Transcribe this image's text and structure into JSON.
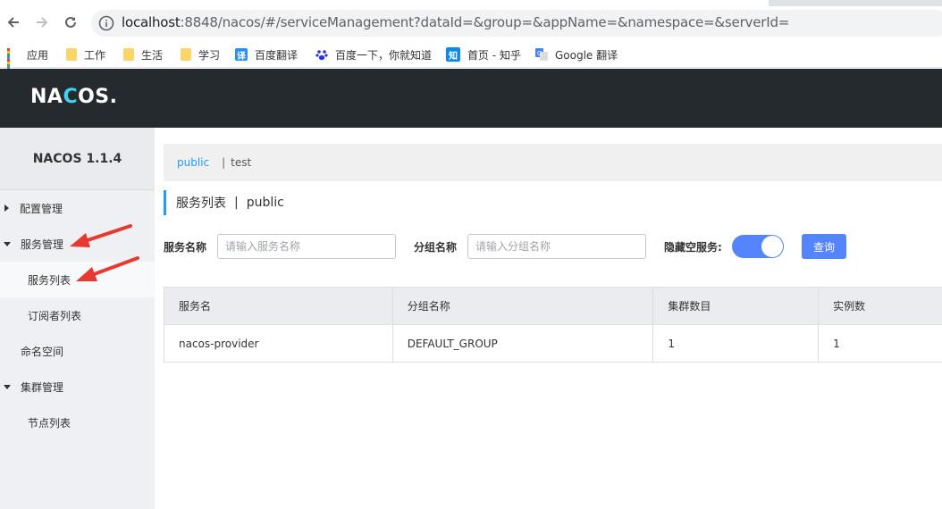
{
  "browser": {
    "url_host": "localhost",
    "url_rest": ":8848/nacos/#/serviceManagement?dataId=&group=&appName=&namespace=&serverId=",
    "bookmarks": [
      {
        "label": "应用",
        "icon": "apps-grid-icon"
      },
      {
        "label": "工作",
        "icon": "folder-icon"
      },
      {
        "label": "生活",
        "icon": "folder-icon"
      },
      {
        "label": "学习",
        "icon": "folder-icon"
      },
      {
        "label": "百度翻译",
        "icon": "baidu-translate-icon"
      },
      {
        "label": "百度一下，你就知道",
        "icon": "baidu-paw-icon"
      },
      {
        "label": "首页 - 知乎",
        "icon": "zhihu-icon"
      },
      {
        "label": "Google 翻译",
        "icon": "google-translate-icon"
      }
    ],
    "icons": {
      "baidu_translate": "译",
      "zhihu": "知"
    }
  },
  "header": {
    "logo_pre": "NA",
    "logo_o": "C",
    "logo_post": "OS."
  },
  "sidebar": {
    "version": "NACOS 1.1.4",
    "items": [
      {
        "label": "配置管理",
        "caret": "right"
      },
      {
        "label": "服务管理",
        "caret": "down"
      },
      {
        "label": "服务列表"
      },
      {
        "label": "订阅者列表"
      },
      {
        "label": "命名空间"
      },
      {
        "label": "集群管理",
        "caret": "down"
      },
      {
        "label": "节点列表"
      }
    ]
  },
  "namespaces": {
    "active": "public",
    "separator": "|",
    "other": "test"
  },
  "page": {
    "title": "服务列表",
    "separator": "|",
    "namespace": "public"
  },
  "filters": {
    "service_name_label": "服务名称",
    "service_name_placeholder": "请输入服务名称",
    "group_name_label": "分组名称",
    "group_name_placeholder": "请输入分组名称",
    "hide_empty_label": "隐藏空服务:",
    "hide_empty_on": true,
    "query_button": "查询"
  },
  "table": {
    "headers": [
      "服务名",
      "分组名称",
      "集群数目",
      "实例数"
    ],
    "rows": [
      [
        "nacos-provider",
        "DEFAULT_GROUP",
        "1",
        "1"
      ]
    ]
  },
  "colors": {
    "accent": "#209bfa",
    "primary_button": "#5584ff",
    "header_bg": "#252a2f",
    "annotation_arrow": "#e8392f"
  }
}
